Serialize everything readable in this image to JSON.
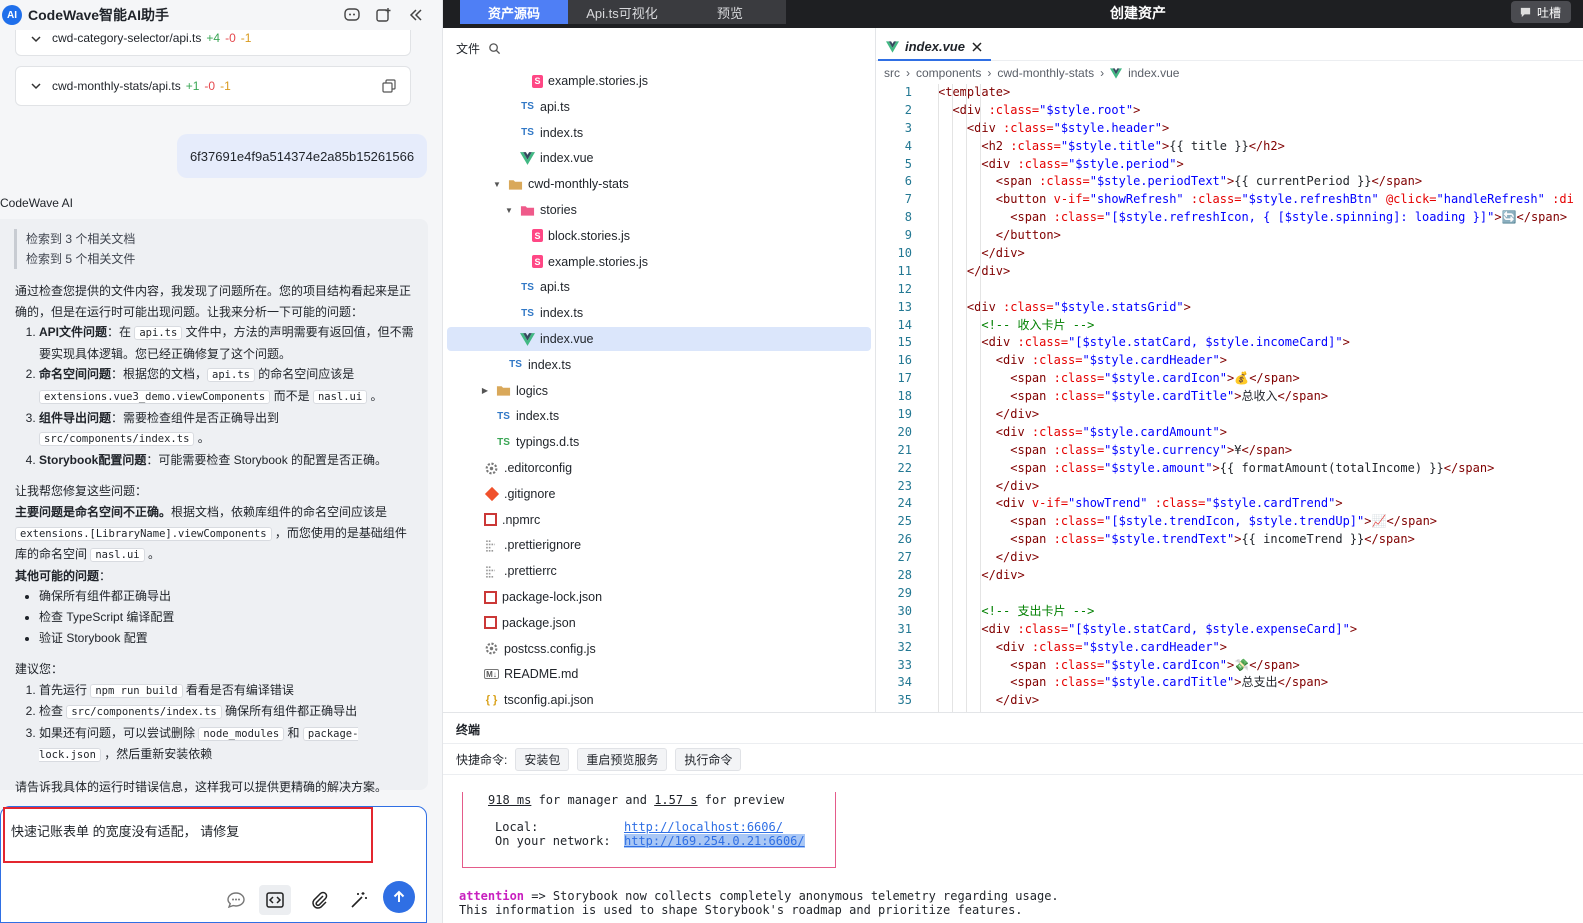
{
  "app": {
    "logo": "AI",
    "title": "CodeWave智能AI助手"
  },
  "header_icons": [
    "chat-bot-icon",
    "new-chat-icon",
    "collapse-icon"
  ],
  "file_changes": [
    {
      "name": "cwd-category-selector/api.ts",
      "added": "+4",
      "removed": "-0",
      "modified": "-1"
    },
    {
      "name": "cwd-monthly-stats/api.ts",
      "added": "+1",
      "removed": "-0",
      "modified": "-1"
    }
  ],
  "user_message": "6f37691e4f9a514374e2a85b15261566",
  "ai_label": "CodeWave AI",
  "ai_reply": {
    "refs": [
      "检索到 3 个相关文档",
      "检索到 5 个相关文件"
    ],
    "intro": "通过检查您提供的文件内容，我发现了问题所在。您的项目结构看起来是正确的，但是在运行时可能出现问题。让我来分析一下可能的问题：",
    "issues": [
      {
        "title": "API文件问题",
        "t1": "：在 ",
        "c1": "api.ts",
        "t2": " 文件中，方法的声明需要有返回值，但不需要实现具体逻辑。您已经正确修复了这个问题。",
        "c2": "",
        "t3": ""
      },
      {
        "title": "命名空间问题",
        "t1": "：根据您的文档，",
        "c1": "api.ts",
        "t2": " 的命名空间应该是 ",
        "c2": "extensions.vue3_demo.viewComponents",
        "t3": " 而不是 "
      },
      {
        "title": "组件导出问题",
        "t1": "：需要检查组件是否正确导出到 ",
        "c1": "src/components/index.ts",
        "t2": " 。",
        "c2": "",
        "t3": ""
      },
      {
        "title": "Storybook配置问题",
        "t1": "：可能需要检查 Storybook 的配置是否正确。",
        "c1": "",
        "t2": "",
        "c2": "",
        "t3": ""
      }
    ],
    "issue2_tail_code": "nasl.ui",
    "issue2_tail": " 。",
    "help": "让我帮您修复这些问题：",
    "main_bold": "主要问题是命名空间不正确。",
    "main_t1": "根据文档，依赖库组件的命名空间应该是 ",
    "main_c1": "extensions.[LibraryName].viewComponents",
    "main_t2": " ，而您使用的是基础组件库的命名空间 ",
    "main_c2": "nasl.ui",
    "main_t3": " 。",
    "other_title": "其他可能的问题",
    "other_colon": "：",
    "other_items": [
      "确保所有组件都正确导出",
      "检查 TypeScript 编译配置",
      "验证 Storybook 配置"
    ],
    "advice": "建议您：",
    "steps": [
      {
        "t1": "首先运行 ",
        "c1": "npm run build",
        "t2": " 看看是否有编译错误",
        "c2": "",
        "t3": ""
      },
      {
        "t1": "检查 ",
        "c1": "src/components/index.ts",
        "t2": " 确保所有组件都正确导出",
        "c2": "",
        "t3": ""
      },
      {
        "t1": "如果还有问题，可以尝试删除 ",
        "c1": "node_modules",
        "t2": " 和 ",
        "c2": "package-lock.json",
        "t3": " ，然后重新安装依赖"
      }
    ],
    "outro": "请告诉我具体的运行时错误信息，这样我可以提供更精确的解决方案。"
  },
  "input": {
    "value": "快速记账表单 的宽度没有适配，  请修复"
  },
  "input_tools": [
    "chat-mode-icon",
    "code-mode-icon",
    "attach-icon",
    "magic-wand-icon",
    "send-icon"
  ],
  "top_tabs": [
    "资产源码",
    "Api.ts可视化",
    "预览"
  ],
  "create_title": "创建资产",
  "feedback_label": "吐槽",
  "file_tree": {
    "header": "文件",
    "rows": [
      {
        "name": "example.stories.js",
        "icon": "stories",
        "indent": 5,
        "chev": ""
      },
      {
        "name": "api.ts",
        "icon": "ts",
        "indent": 4,
        "chev": ""
      },
      {
        "name": "index.ts",
        "icon": "ts",
        "indent": 4,
        "chev": ""
      },
      {
        "name": "index.vue",
        "icon": "vue",
        "indent": 4,
        "chev": ""
      },
      {
        "name": "cwd-monthly-stats",
        "icon": "folder",
        "indent": 3,
        "chev": "▼"
      },
      {
        "name": "stories",
        "icon": "folder-pink",
        "indent": 4,
        "chev": "▼"
      },
      {
        "name": "block.stories.js",
        "icon": "stories",
        "indent": 5,
        "chev": ""
      },
      {
        "name": "example.stories.js",
        "icon": "stories",
        "indent": 5,
        "chev": ""
      },
      {
        "name": "api.ts",
        "icon": "ts",
        "indent": 4,
        "chev": ""
      },
      {
        "name": "index.ts",
        "icon": "ts",
        "indent": 4,
        "chev": ""
      },
      {
        "name": "index.vue",
        "icon": "vue",
        "indent": 4,
        "chev": "",
        "selected": true
      },
      {
        "name": "index.ts",
        "icon": "ts",
        "indent": 3,
        "chev": ""
      },
      {
        "name": "logics",
        "icon": "folder",
        "indent": 2,
        "chev": "▶"
      },
      {
        "name": "index.ts",
        "icon": "ts",
        "indent": 2,
        "chev": ""
      },
      {
        "name": "typings.d.ts",
        "icon": "ts-green",
        "indent": 2,
        "chev": ""
      },
      {
        "name": ".editorconfig",
        "icon": "gear",
        "indent": 1,
        "chev": ""
      },
      {
        "name": ".gitignore",
        "icon": "git",
        "indent": 1,
        "chev": ""
      },
      {
        "name": ".npmrc",
        "icon": "npm",
        "indent": 1,
        "chev": ""
      },
      {
        "name": ".prettierignore",
        "icon": "prettier",
        "indent": 1,
        "chev": ""
      },
      {
        "name": ".prettierrc",
        "icon": "prettier",
        "indent": 1,
        "chev": ""
      },
      {
        "name": "package-lock.json",
        "icon": "npm",
        "indent": 1,
        "chev": ""
      },
      {
        "name": "package.json",
        "icon": "npm",
        "indent": 1,
        "chev": ""
      },
      {
        "name": "postcss.config.js",
        "icon": "gear",
        "indent": 1,
        "chev": ""
      },
      {
        "name": "README.md",
        "icon": "md",
        "indent": 1,
        "chev": ""
      },
      {
        "name": "tsconfig.api.json",
        "icon": "json",
        "indent": 1,
        "chev": ""
      }
    ]
  },
  "editor": {
    "tab": "index.vue",
    "breadcrumb": [
      "src",
      "components",
      "cwd-monthly-stats",
      "index.vue"
    ],
    "lines": [
      [
        [
          "tg",
          "<template>"
        ]
      ],
      [
        [
          "tg",
          "  <div "
        ],
        [
          "at",
          ":class="
        ],
        [
          "sv",
          "\"$style.root\""
        ],
        [
          "tg",
          ">"
        ]
      ],
      [
        [
          "tg",
          "    <div "
        ],
        [
          "at",
          ":class="
        ],
        [
          "sv",
          "\"$style.header\""
        ],
        [
          "tg",
          ">"
        ]
      ],
      [
        [
          "tg",
          "      <h2 "
        ],
        [
          "at",
          ":class="
        ],
        [
          "sv",
          "\"$style.title\""
        ],
        [
          "tg",
          ">"
        ],
        [
          "br",
          "{{ title }}"
        ],
        [
          "tg",
          "</h2>"
        ]
      ],
      [
        [
          "tg",
          "      <div "
        ],
        [
          "at",
          ":class="
        ],
        [
          "sv",
          "\"$style.period\""
        ],
        [
          "tg",
          ">"
        ]
      ],
      [
        [
          "tg",
          "        <span "
        ],
        [
          "at",
          ":class="
        ],
        [
          "sv",
          "\"$style.periodText\""
        ],
        [
          "tg",
          ">"
        ],
        [
          "br",
          "{{ currentPeriod }}"
        ],
        [
          "tg",
          "</span>"
        ]
      ],
      [
        [
          "tg",
          "        <button "
        ],
        [
          "at",
          "v-if="
        ],
        [
          "sv",
          "\"showRefresh\""
        ],
        [
          "at",
          " :class="
        ],
        [
          "sv",
          "\"$style.refreshBtn\""
        ],
        [
          "at",
          " @click="
        ],
        [
          "sv",
          "\"handleRefresh\""
        ],
        [
          "at",
          " :di"
        ]
      ],
      [
        [
          "tg",
          "          <span "
        ],
        [
          "at",
          ":class="
        ],
        [
          "sv",
          "\"[$style.refreshIcon, { [$style.spinning]: loading }]\""
        ],
        [
          "tg",
          ">"
        ],
        [
          "br",
          "🔄"
        ],
        [
          "tg",
          "</span>"
        ]
      ],
      [
        [
          "tg",
          "        </button>"
        ]
      ],
      [
        [
          "tg",
          "      </div>"
        ]
      ],
      [
        [
          "tg",
          "    </div>"
        ]
      ],
      [
        [
          "br",
          ""
        ]
      ],
      [
        [
          "tg",
          "    <div "
        ],
        [
          "at",
          ":class="
        ],
        [
          "sv",
          "\"$style.statsGrid\""
        ],
        [
          "tg",
          ">"
        ]
      ],
      [
        [
          "cm",
          "      <!-- 收入卡片 -->"
        ]
      ],
      [
        [
          "tg",
          "      <div "
        ],
        [
          "at",
          ":class="
        ],
        [
          "sv",
          "\"[$style.statCard, $style.incomeCard]\""
        ],
        [
          "tg",
          ">"
        ]
      ],
      [
        [
          "tg",
          "        <div "
        ],
        [
          "at",
          ":class="
        ],
        [
          "sv",
          "\"$style.cardHeader\""
        ],
        [
          "tg",
          ">"
        ]
      ],
      [
        [
          "tg",
          "          <span "
        ],
        [
          "at",
          ":class="
        ],
        [
          "sv",
          "\"$style.cardIcon\""
        ],
        [
          "tg",
          ">"
        ],
        [
          "br",
          "💰"
        ],
        [
          "tg",
          "</span>"
        ]
      ],
      [
        [
          "tg",
          "          <span "
        ],
        [
          "at",
          ":class="
        ],
        [
          "sv",
          "\"$style.cardTitle\""
        ],
        [
          "tg",
          ">"
        ],
        [
          "br",
          "总收入"
        ],
        [
          "tg",
          "</span>"
        ]
      ],
      [
        [
          "tg",
          "        </div>"
        ]
      ],
      [
        [
          "tg",
          "        <div "
        ],
        [
          "at",
          ":class="
        ],
        [
          "sv",
          "\"$style.cardAmount\""
        ],
        [
          "tg",
          ">"
        ]
      ],
      [
        [
          "tg",
          "          <span "
        ],
        [
          "at",
          ":class="
        ],
        [
          "sv",
          "\"$style.currency\""
        ],
        [
          "tg",
          ">"
        ],
        [
          "br",
          "¥"
        ],
        [
          "tg",
          "</span>"
        ]
      ],
      [
        [
          "tg",
          "          <span "
        ],
        [
          "at",
          ":class="
        ],
        [
          "sv",
          "\"$style.amount\""
        ],
        [
          "tg",
          ">"
        ],
        [
          "br",
          "{{ formatAmount(totalIncome) }}"
        ],
        [
          "tg",
          "</span>"
        ]
      ],
      [
        [
          "tg",
          "        </div>"
        ]
      ],
      [
        [
          "tg",
          "        <div "
        ],
        [
          "at",
          "v-if="
        ],
        [
          "sv",
          "\"showTrend\""
        ],
        [
          "at",
          " :class="
        ],
        [
          "sv",
          "\"$style.cardTrend\""
        ],
        [
          "tg",
          ">"
        ]
      ],
      [
        [
          "tg",
          "          <span "
        ],
        [
          "at",
          ":class="
        ],
        [
          "sv",
          "\"[$style.trendIcon, $style.trendUp]\""
        ],
        [
          "tg",
          ">"
        ],
        [
          "br",
          "📈"
        ],
        [
          "tg",
          "</span>"
        ]
      ],
      [
        [
          "tg",
          "          <span "
        ],
        [
          "at",
          ":class="
        ],
        [
          "sv",
          "\"$style.trendText\""
        ],
        [
          "tg",
          ">"
        ],
        [
          "br",
          "{{ incomeTrend }}"
        ],
        [
          "tg",
          "</span>"
        ]
      ],
      [
        [
          "tg",
          "        </div>"
        ]
      ],
      [
        [
          "tg",
          "      </div>"
        ]
      ],
      [
        [
          "br",
          ""
        ]
      ],
      [
        [
          "cm",
          "      <!-- 支出卡片 -->"
        ]
      ],
      [
        [
          "tg",
          "      <div "
        ],
        [
          "at",
          ":class="
        ],
        [
          "sv",
          "\"[$style.statCard, $style.expenseCard]\""
        ],
        [
          "tg",
          ">"
        ]
      ],
      [
        [
          "tg",
          "        <div "
        ],
        [
          "at",
          ":class="
        ],
        [
          "sv",
          "\"$style.cardHeader\""
        ],
        [
          "tg",
          ">"
        ]
      ],
      [
        [
          "tg",
          "          <span "
        ],
        [
          "at",
          ":class="
        ],
        [
          "sv",
          "\"$style.cardIcon\""
        ],
        [
          "tg",
          ">"
        ],
        [
          "br",
          "💸"
        ],
        [
          "tg",
          "</span>"
        ]
      ],
      [
        [
          "tg",
          "          <span "
        ],
        [
          "at",
          ":class="
        ],
        [
          "sv",
          "\"$style.cardTitle\""
        ],
        [
          "tg",
          ">"
        ],
        [
          "br",
          "总支出"
        ],
        [
          "tg",
          "</span>"
        ]
      ],
      [
        [
          "tg",
          "        </div>"
        ]
      ]
    ]
  },
  "terminal": {
    "title": "终端",
    "quick_label": "快捷命令:",
    "quick_buttons": [
      "安装包",
      "重启预览服务",
      "执行命令"
    ],
    "timing": {
      "ms1": "918 ms",
      "t1": " for manager and ",
      "ms2": "1.57 s",
      "t2": " for preview"
    },
    "local_label": "Local:",
    "local_url": "http://localhost:6606/",
    "network_label": "On your network:",
    "network_url": "http://169.254.0.21:6606/",
    "attention": "attention",
    "attention_text": " => Storybook now collects completely anonymous telemetry regarding usage.",
    "info_text": "This information is used to shape Storybook's roadmap and prioritize features."
  },
  "colors": {
    "accent": "#2f6fe4",
    "tab_active": "#4f7ff5",
    "highlight_red": "#e3262f"
  }
}
